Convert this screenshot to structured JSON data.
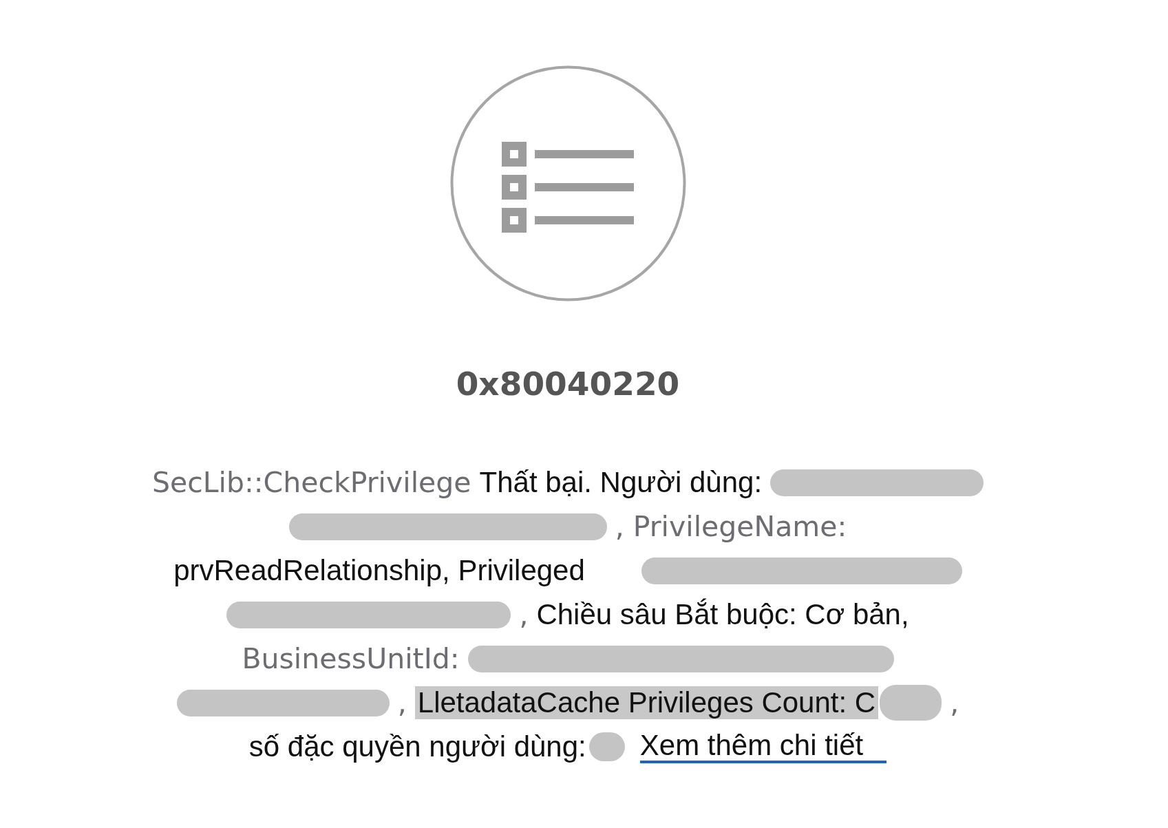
{
  "error_code": "0x80040220",
  "message": {
    "lines": [
      {
        "segments": [
          {
            "kind": "muted",
            "text": "SecLib::CheckPrivilege"
          },
          {
            "kind": "plain",
            "text": "Thất bại. Người dùng:"
          },
          {
            "kind": "redacted"
          }
        ]
      },
      {
        "segments": [
          {
            "kind": "redacted"
          },
          {
            "kind": "muted",
            "text": ", PrivilegeName:"
          }
        ]
      },
      {
        "segments": [
          {
            "kind": "plain",
            "text": "prvReadRelationship, Privileged"
          },
          {
            "kind": "redacted"
          }
        ]
      },
      {
        "segments": [
          {
            "kind": "redacted"
          },
          {
            "kind": "muted",
            "text": ","
          },
          {
            "kind": "plain",
            "text": "Chiều sâu Bắt buộc: Cơ bản,"
          }
        ]
      },
      {
        "segments": [
          {
            "kind": "muted",
            "text": "BusinessUnitId:"
          },
          {
            "kind": "redacted"
          }
        ]
      },
      {
        "segments": [
          {
            "kind": "redacted"
          },
          {
            "kind": "muted",
            "text": ","
          },
          {
            "kind": "highlight",
            "text": "LletadataCache Privileges Count: C"
          },
          {
            "kind": "redacted"
          },
          {
            "kind": "muted",
            "text": ","
          }
        ]
      },
      {
        "segments": [
          {
            "kind": "plain",
            "text": "số đặc quyền người dùng:"
          },
          {
            "kind": "redacted"
          },
          {
            "kind": "link",
            "text": "Xem thêm chi tiết"
          }
        ]
      }
    ]
  }
}
